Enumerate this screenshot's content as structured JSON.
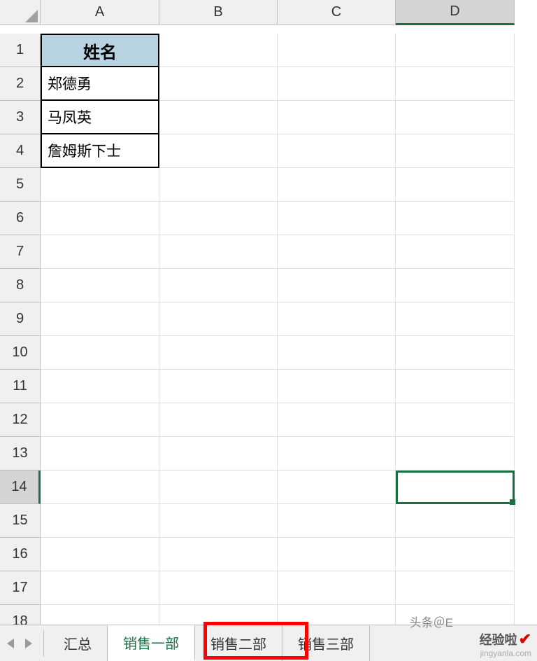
{
  "columns": [
    "A",
    "B",
    "C",
    "D"
  ],
  "rows": [
    "1",
    "2",
    "3",
    "4",
    "5",
    "6",
    "7",
    "8",
    "9",
    "10",
    "11",
    "12",
    "13",
    "14",
    "15",
    "16",
    "17",
    "18"
  ],
  "cells": {
    "A1": "姓名",
    "A2": "郑德勇",
    "A3": "马凤英",
    "A4": "詹姆斯下士"
  },
  "selected_cell": "D14",
  "sheet_tabs": {
    "items": [
      "汇总",
      "销售一部",
      "销售二部",
      "销售三部"
    ],
    "active_index": 1
  },
  "watermark": {
    "author": "头条＠E",
    "site": "经验啦",
    "domain": "jingyanla.com"
  }
}
